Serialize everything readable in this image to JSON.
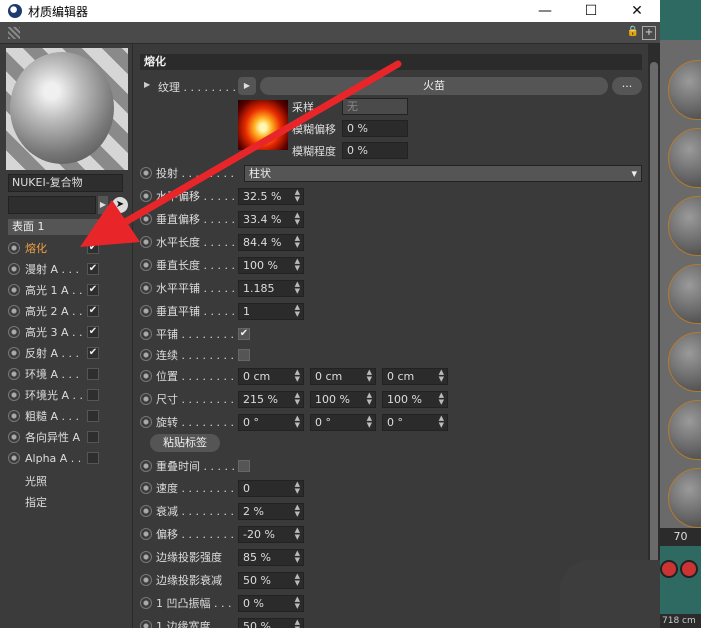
{
  "window": {
    "title": "材质编辑器",
    "minimize_icon": "minimize-icon",
    "maximize_icon": "maximize-icon",
    "close_icon": "close-icon"
  },
  "toolbar": {
    "lock_icon": "lock-icon",
    "add_icon": "add-icon"
  },
  "left_panel": {
    "material_name": "NUKEI-复合物",
    "surface_label": "表面 1",
    "channels": [
      {
        "label": "熔化",
        "checked": true,
        "active": true
      },
      {
        "label": "漫射 A . . .",
        "checked": true,
        "active": false
      },
      {
        "label": "高光 1 A . .",
        "checked": true,
        "active": false
      },
      {
        "label": "高光 2 A . .",
        "checked": true,
        "active": false
      },
      {
        "label": "高光 3 A . .",
        "checked": true,
        "active": false
      },
      {
        "label": "反射 A . . .",
        "checked": true,
        "active": false
      },
      {
        "label": "环境 A . . .",
        "checked": false,
        "active": false
      },
      {
        "label": "环境光 A . .",
        "checked": false,
        "active": false
      },
      {
        "label": "粗糙 A . . .",
        "checked": false,
        "active": false
      },
      {
        "label": "各向异性 A",
        "checked": false,
        "active": false
      },
      {
        "label": "Alpha A . .",
        "checked": false,
        "active": false
      }
    ],
    "extra_items": [
      "光照",
      "指定"
    ]
  },
  "main": {
    "section_title": "熔化",
    "texture": {
      "label": "纹理 . . . . . . . .",
      "name": "火苗",
      "more_label": "...",
      "sampling_label": "采样",
      "sampling_value": "无",
      "blur_offset_label": "模糊偏移",
      "blur_offset_value": "0 %",
      "blur_scale_label": "模糊程度",
      "blur_scale_value": "0 %"
    },
    "projection": {
      "label": "投射 . . . . . . . .",
      "value": "柱状"
    },
    "offset_u": {
      "label": "水平偏移 . . . . .",
      "value": "32.5 %"
    },
    "offset_v": {
      "label": "垂直偏移 . . . . .",
      "value": "33.4 %"
    },
    "length_u": {
      "label": "水平长度 . . . . .",
      "value": "84.4 %"
    },
    "length_v": {
      "label": "垂直长度 . . . . .",
      "value": "100 %"
    },
    "tiles_u": {
      "label": "水平平铺 . . . . .",
      "value": "1.185"
    },
    "tiles_v": {
      "label": "垂直平铺 . . . . .",
      "value": "1"
    },
    "tile": {
      "label": "平铺 . . . . . . . .",
      "checked": true
    },
    "seamless": {
      "label": "连续 . . . . . . . .",
      "checked": false
    },
    "position": {
      "label": "位置 . . . . . . . .",
      "values": [
        "0 cm",
        "0 cm",
        "0 cm"
      ]
    },
    "size": {
      "label": "尺寸 . . . . . . . .",
      "values": [
        "215 %",
        "100 %",
        "100 %"
      ]
    },
    "rotation": {
      "label": "旋转 . . . . . . . .",
      "values": [
        "0 °",
        "0 °",
        "0 °"
      ]
    },
    "paste_button": "粘贴标签",
    "overlap_time": {
      "label": "重叠时间 . . . . .",
      "checked": false
    },
    "speed": {
      "label": "速度 . . . . . . . .",
      "value": "0"
    },
    "decay": {
      "label": "衰减 . . . . . . . .",
      "value": "2 %"
    },
    "offset": {
      "label": "偏移 . . . . . . . .",
      "value": "-20 %"
    },
    "edge_strength": {
      "label": "边缘投影强度",
      "value": "85 %"
    },
    "edge_decay": {
      "label": "边缘投影衰减",
      "value": "50 %"
    },
    "bump_amp": {
      "label": "1 凹凸振幅 . . .",
      "value": "0 %"
    },
    "edge_width": {
      "label": "1 边缘宽度 . . .",
      "value": "50 %"
    }
  },
  "viewport": {
    "frame_number": "70",
    "size_readout": "718 cm"
  },
  "colors": {
    "accent_active": "#f0a040",
    "annotation_arrow": "#e8262a"
  }
}
